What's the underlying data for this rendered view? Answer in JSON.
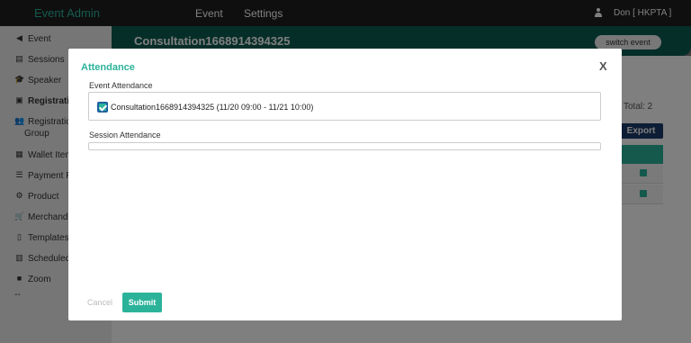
{
  "app": {
    "brand": "Event Admin"
  },
  "topnav": {
    "event": "Event",
    "settings": "Settings",
    "user": "Don [ HKPTA ]"
  },
  "sidebar": {
    "items": [
      {
        "icon": "megaphone-icon",
        "glyph": "◀",
        "label": "Event",
        "label2": ""
      },
      {
        "icon": "sessions-icon",
        "glyph": "▤",
        "label": "Sessions",
        "label2": ""
      },
      {
        "icon": "speaker-icon",
        "glyph": "🎓",
        "label": "Speaker",
        "label2": ""
      },
      {
        "icon": "registration-icon",
        "glyph": "▣",
        "label": "Registrati",
        "label2": ""
      },
      {
        "icon": "group-icon",
        "glyph": "👥",
        "label": "Registratio",
        "label2": "Group"
      },
      {
        "icon": "wallet-icon",
        "glyph": "▦",
        "label": "Wallet Item",
        "label2": ""
      },
      {
        "icon": "payment-icon",
        "glyph": "☰",
        "label": "Payment R",
        "label2": ""
      },
      {
        "icon": "product-icon",
        "glyph": "⚙",
        "label": "Product",
        "label2": ""
      },
      {
        "icon": "cart-icon",
        "glyph": "🛒",
        "label": "Merchandi",
        "label2": ""
      },
      {
        "icon": "templates-icon",
        "glyph": "▯",
        "label": "Templates",
        "label2": ""
      },
      {
        "icon": "calendar-icon",
        "glyph": "▥",
        "label": "Scheduled",
        "label2": ""
      },
      {
        "icon": "video-icon",
        "glyph": "■",
        "label": "Zoom",
        "label2": ""
      }
    ],
    "dash": "--"
  },
  "event_header": {
    "title": "Consultation1668914394325",
    "switch_label": "switch event"
  },
  "main": {
    "total": "Total: 2",
    "export_label": "Export"
  },
  "modal": {
    "title": "Attendance",
    "close": "X",
    "event_attendance_label": "Event Attendance",
    "event_option": "Consultation1668914394325 (11/20 09:00 - 11/21 10:00)",
    "event_option_checked": true,
    "session_attendance_label": "Session Attendance",
    "cancel_label": "Cancel",
    "submit_label": "Submit"
  },
  "colors": {
    "accent": "#2bb39a",
    "header": "#0d5c52",
    "topbar": "#1f1f1f",
    "export": "#1a3a6b"
  }
}
